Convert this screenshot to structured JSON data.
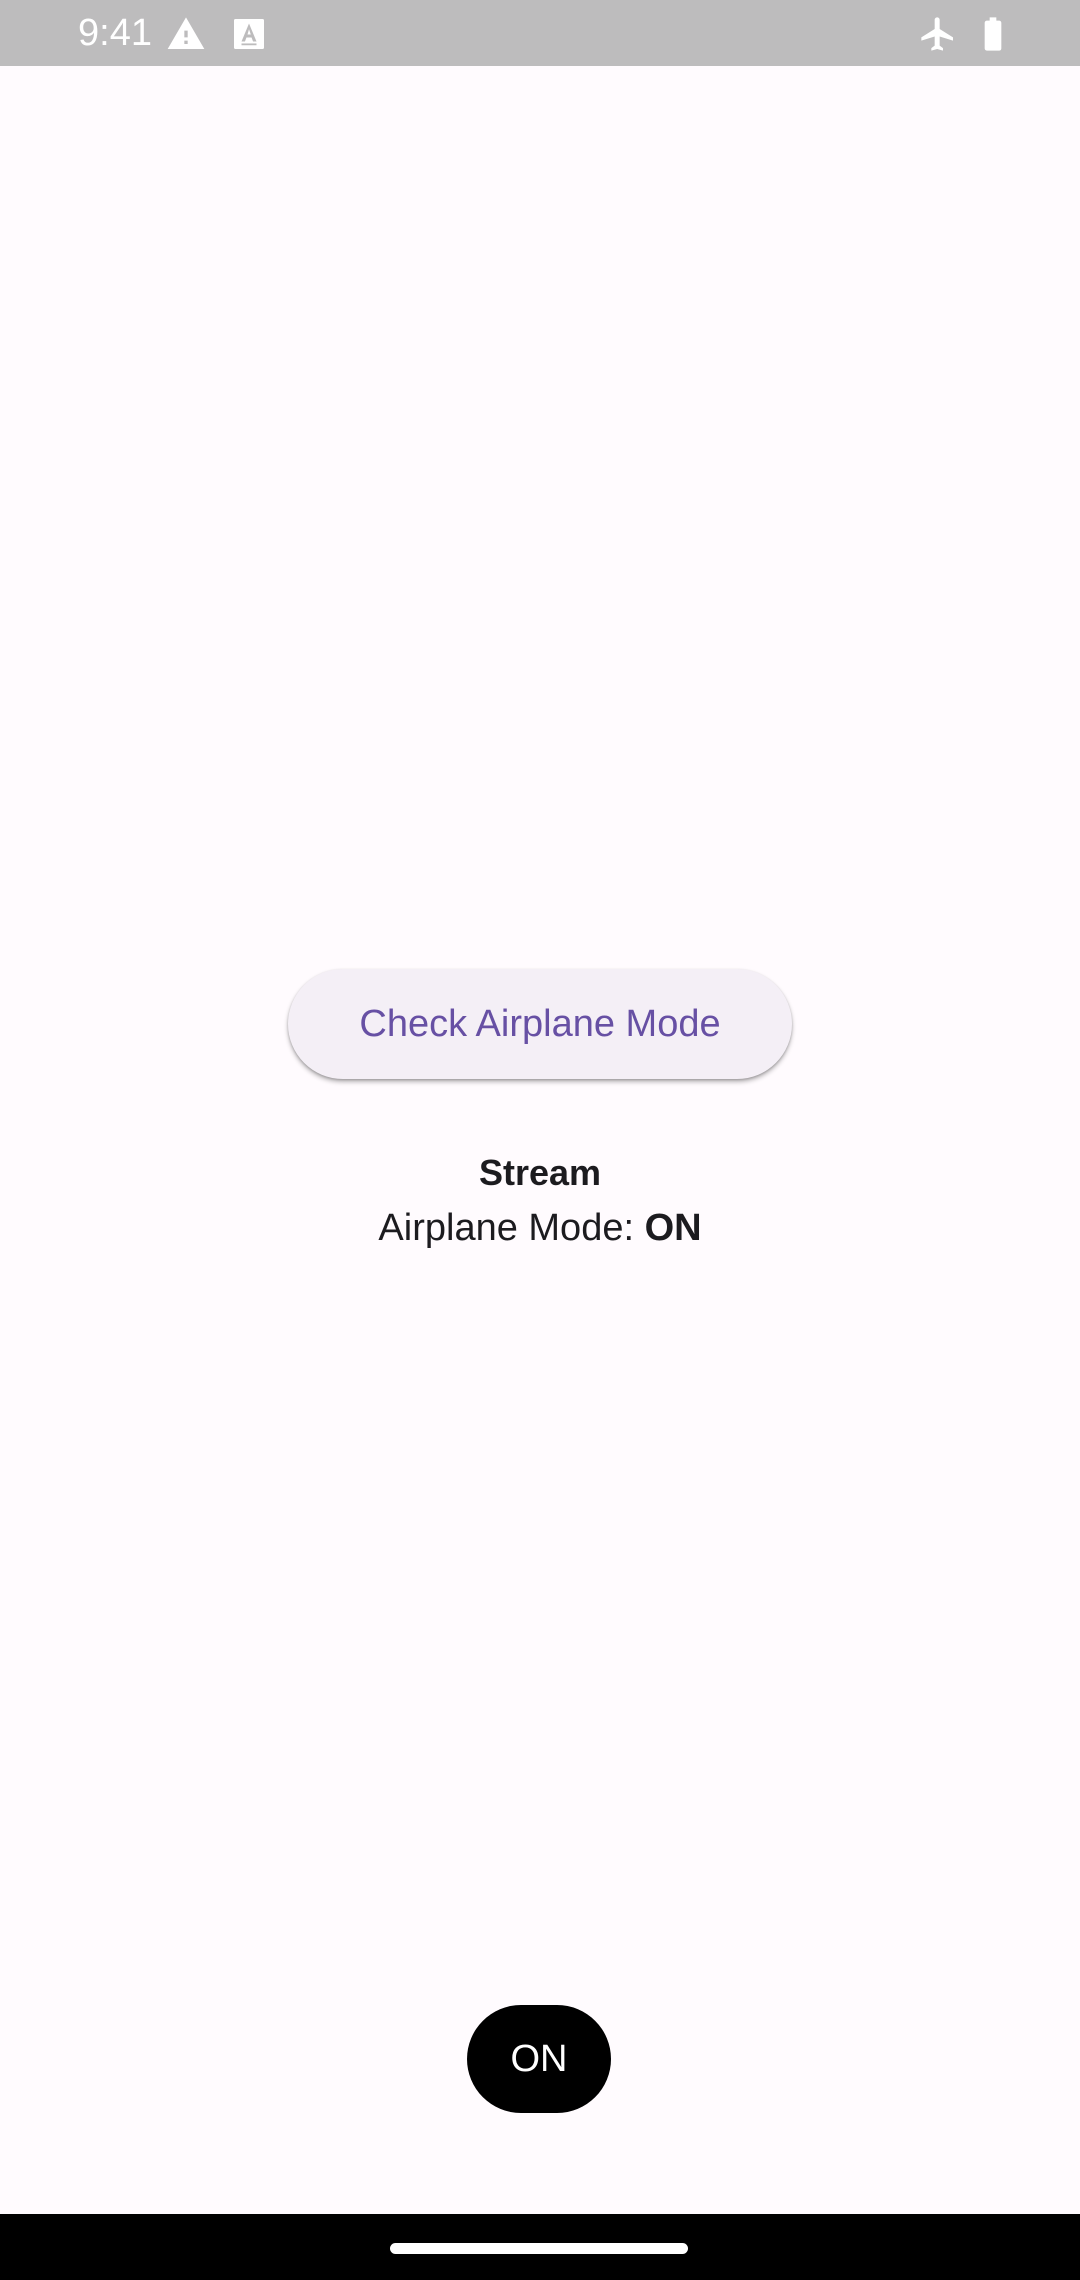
{
  "status_bar": {
    "time": "9:41",
    "icons": [
      "warning-icon",
      "font-a-icon",
      "airplane-icon",
      "battery-icon"
    ],
    "background": "#bdbcbd"
  },
  "main": {
    "check_button_label": "Check Airplane Mode",
    "stream_title": "Stream",
    "status_label": "Airplane Mode: ",
    "status_value": "ON"
  },
  "indicator": {
    "label": "ON"
  },
  "colors": {
    "accent": "#6750a4",
    "background": "#fffbfe",
    "button_surface": "#f4eff6",
    "text": "#1c1b1f"
  }
}
